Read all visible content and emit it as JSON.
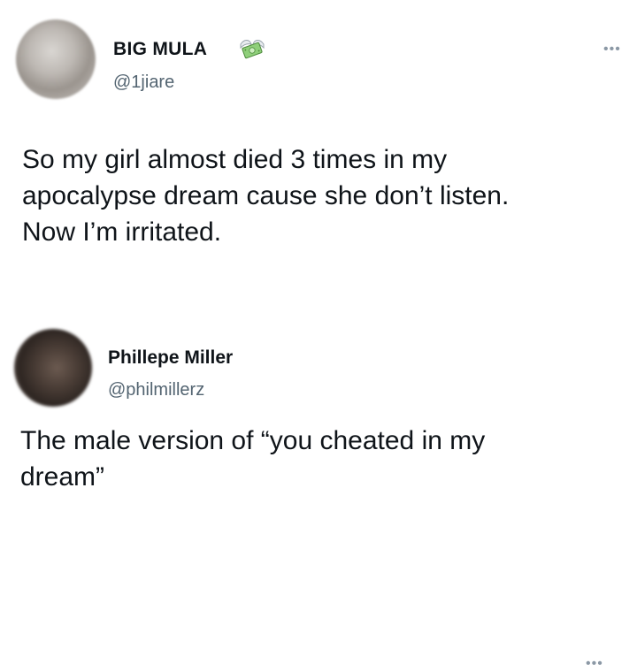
{
  "tweets": [
    {
      "display_name": "BIG MULA",
      "handle": "@1jiare",
      "badge_icon": "money-with-wings-icon",
      "more_icon": "more-options-icon",
      "text_lines": [
        "So my girl almost died 3 times in my",
        "apocalypse dream cause she don’t listen.",
        "Now I’m irritated."
      ]
    },
    {
      "display_name": "Phillepe Miller",
      "handle": "@philmillerz",
      "more_icon": "more-options-icon",
      "text_lines": [
        "The male version of “you cheated in my",
        "dream”"
      ]
    }
  ],
  "colors": {
    "background": "#ffffff",
    "text_primary": "#0f1419",
    "text_secondary": "#536471",
    "icon_muted": "#8b98a5"
  }
}
